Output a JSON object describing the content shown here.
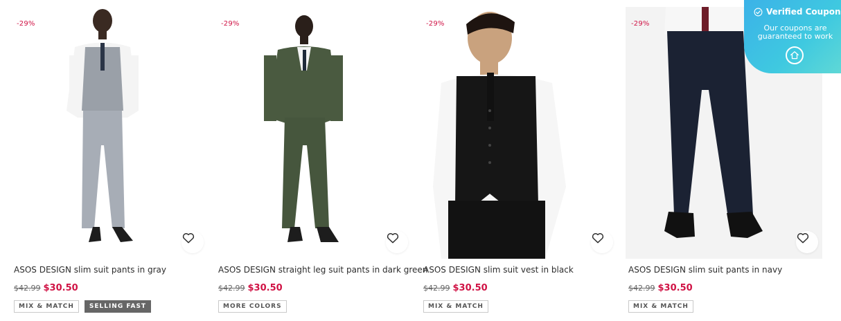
{
  "products": [
    {
      "discount": "-29%",
      "title": "ASOS DESIGN slim suit pants in gray",
      "old_price": "$42.99",
      "new_price": "$30.50",
      "badges": [
        "MIX & MATCH",
        "SELLING FAST"
      ],
      "image": "model-gray-suit"
    },
    {
      "discount": "-29%",
      "title": "ASOS DESIGN straight leg suit pants in dark green",
      "old_price": "$42.99",
      "new_price": "$30.50",
      "badges": [
        "MORE COLORS"
      ],
      "image": "model-green-suit"
    },
    {
      "discount": "-29%",
      "title": "ASOS DESIGN slim suit vest in black",
      "old_price": "$42.99",
      "new_price": "$30.50",
      "badges": [
        "MIX & MATCH"
      ],
      "image": "model-black-vest"
    },
    {
      "discount": "-29%",
      "title": "ASOS DESIGN slim suit pants in navy",
      "old_price": "$42.99",
      "new_price": "$30.50",
      "badges": [
        "MIX & MATCH"
      ],
      "image": "model-navy-pants"
    }
  ],
  "coupon": {
    "heading": "Verified Coupon",
    "subtext": "Our coupons are guaranteed to work",
    "icon": "home-icon"
  },
  "icons": {
    "save": "heart-icon",
    "verified": "check-circle-icon"
  },
  "colors": {
    "sale": "#d01345",
    "badge_dark": "#666666",
    "coupon_gradient_start": "#3bb2e8",
    "coupon_gradient_end": "#5fd8d6"
  }
}
